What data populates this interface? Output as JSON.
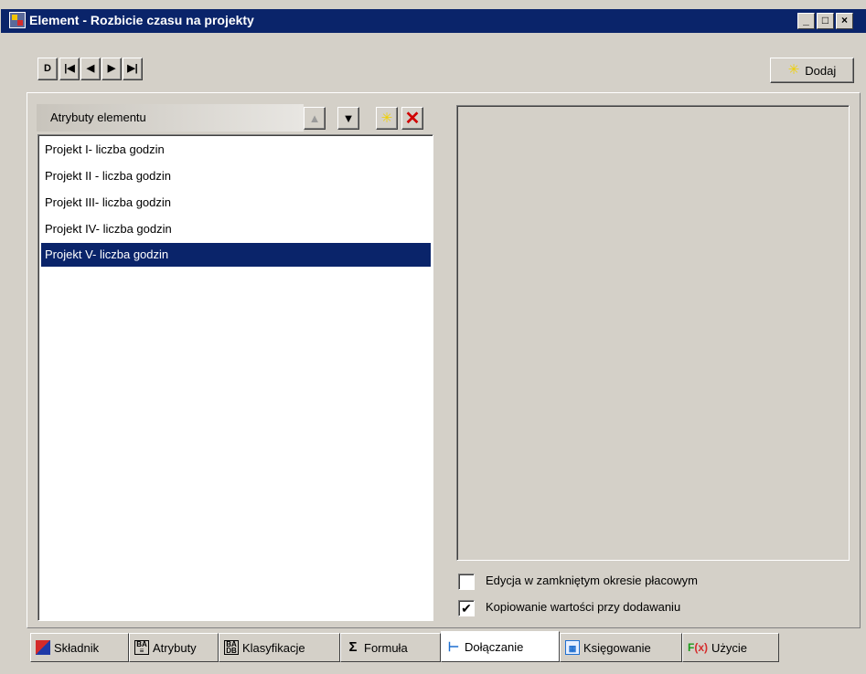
{
  "window": {
    "title": "Element - Rozbicie czasu na projekty",
    "caption_buttons": {
      "minimize": "_",
      "maximize": "□",
      "close": "×"
    }
  },
  "toolbar": {
    "nav": [
      "D",
      "|◀",
      "◀",
      "▶",
      "▶|"
    ],
    "add_label": "Dodaj"
  },
  "attributes": {
    "header": "Atrybuty elementu",
    "items": [
      {
        "label": "Projekt I- liczba godzin",
        "selected": false
      },
      {
        "label": "Projekt II - liczba godzin",
        "selected": false
      },
      {
        "label": "Projekt III- liczba godzin",
        "selected": false
      },
      {
        "label": "Projekt IV- liczba godzin",
        "selected": false
      },
      {
        "label": "Projekt V- liczba godzin",
        "selected": true
      }
    ]
  },
  "options": {
    "edit_closed_period": {
      "label": "Edycja w zamkniętym okresie płacowym",
      "checked": false
    },
    "copy_on_add": {
      "label": "Kopiowanie wartości przy dodawaniu",
      "checked": true
    }
  },
  "tabs": [
    {
      "id": "skladnik",
      "label": "Składnik",
      "icon": "component-icon",
      "active": false
    },
    {
      "id": "atrybuty",
      "label": "Atrybuty",
      "icon": "attributes-icon",
      "active": false
    },
    {
      "id": "klasyfikacje",
      "label": "Klasyfikacje",
      "icon": "classification-icon",
      "active": false
    },
    {
      "id": "formula",
      "label": "Formuła",
      "icon": "formula-icon",
      "active": false
    },
    {
      "id": "dolaczanie",
      "label": "Dołączanie",
      "icon": "attach-icon",
      "active": true
    },
    {
      "id": "ksiegowanie",
      "label": "Księgowanie",
      "icon": "ledger-icon",
      "active": false
    },
    {
      "id": "uzycie",
      "label": "Użycie",
      "icon": "function-icon",
      "active": false
    }
  ],
  "colors": {
    "title_bar": "#0a246a",
    "face": "#d4d0c8",
    "selection": "#0a246a"
  }
}
